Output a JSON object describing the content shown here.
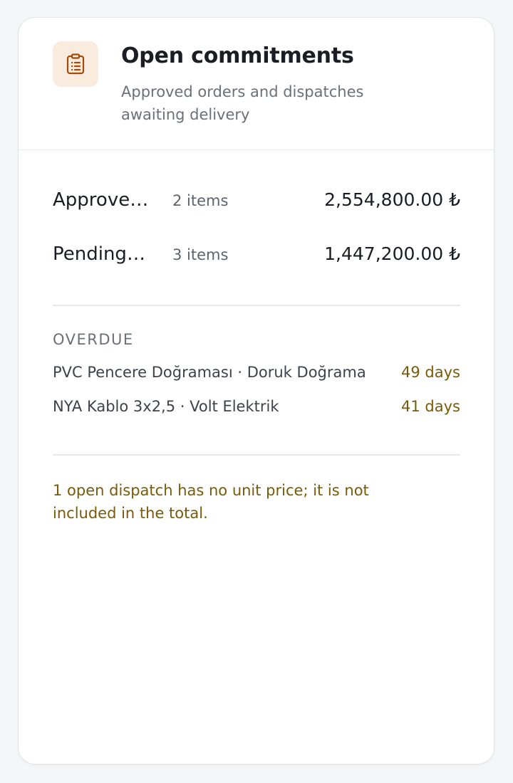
{
  "header": {
    "title": "Open commitments",
    "subtitle": "Approved orders and dispatches awaiting delivery",
    "icon": "clipboard-list-icon",
    "icon_color": "#a24a0b",
    "icon_bg": "#f9ecdf"
  },
  "summary": [
    {
      "label": "Approved orders",
      "count": "2 items",
      "amount": "2,554,800.00 ₺"
    },
    {
      "label": "Pending dispatches",
      "count": "3 items",
      "amount": "1,447,200.00 ₺"
    }
  ],
  "overdue": {
    "label": "OVERDUE",
    "items": [
      {
        "name": "PVC Pencere Doğraması · Doruk Doğrama",
        "days": "49 days"
      },
      {
        "name": "NYA Kablo 3x2,5 · Volt Elektrik",
        "days": "41 days"
      }
    ]
  },
  "note": "1 open dispatch has no unit price; it is not included in the total.",
  "colors": {
    "warning": "#7a5a06",
    "text": "#1a1d23",
    "muted": "#6b7079"
  }
}
